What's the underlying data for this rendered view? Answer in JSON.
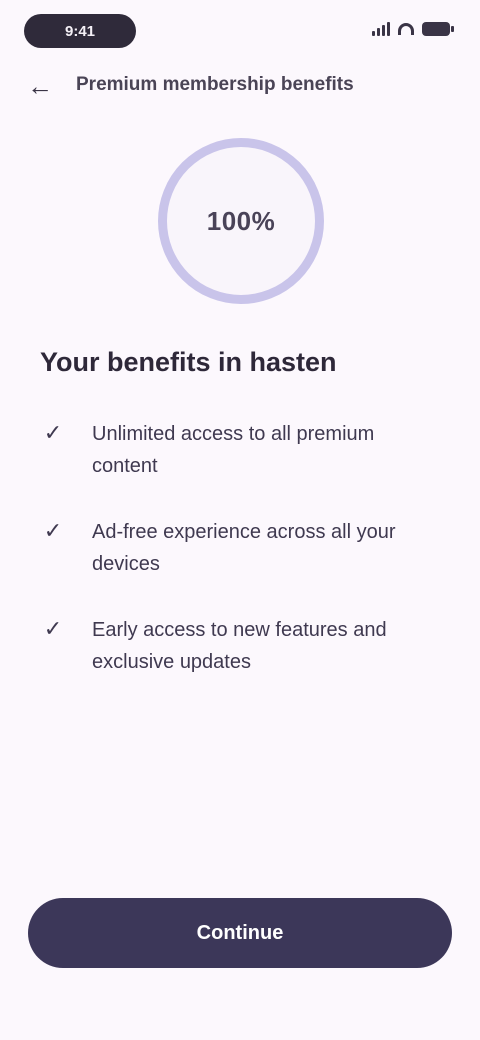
{
  "status_bar": {
    "time": "9:41"
  },
  "header": {
    "back_icon": "arrow-left-icon",
    "title": "Premium membership benefits"
  },
  "badge": {
    "label": "100%"
  },
  "content": {
    "title": "Your benefits in hasten",
    "benefits": [
      {
        "text": "Unlimited access to all premium content",
        "icon": "check-icon"
      },
      {
        "text": "Ad-free experience across all your devices",
        "icon": "check-icon"
      },
      {
        "text": "Early access to new features and exclusive updates",
        "icon": "check-icon"
      }
    ]
  },
  "cta": {
    "label": "Continue"
  },
  "colors": {
    "background": "#fcf8fd",
    "badge_ring": "#c9c4ea",
    "button": "#3c3759"
  }
}
